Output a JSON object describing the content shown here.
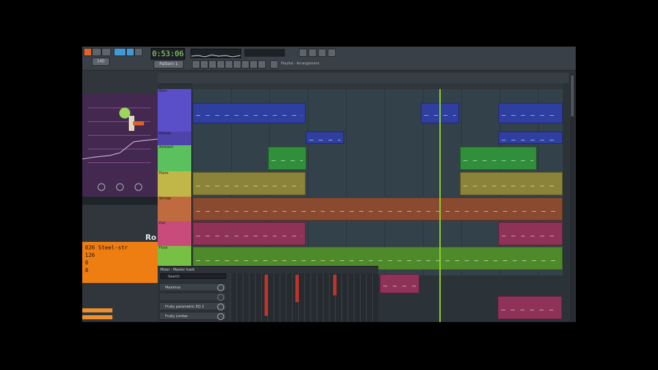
{
  "toolbar": {
    "time": "0:53:06",
    "tempo": "140",
    "pattern": "Pattern 1",
    "hint": "Playlist - Arrangement"
  },
  "left": {
    "roll_label": "Ro",
    "roll_lines": [
      "026 Steel-str",
      "126",
      "0",
      "0"
    ]
  },
  "tracks": [
    {
      "name": "Bass",
      "color": "#5b4fc9"
    },
    {
      "name": "Melody",
      "color": "#5b4fc9"
    },
    {
      "name": "Ambient",
      "color": "#5bc15e"
    },
    {
      "name": "Piano",
      "color": "#c1b648"
    },
    {
      "name": "Strings",
      "color": "#c06a3f"
    },
    {
      "name": "Pad",
      "color": "#c94b7b"
    },
    {
      "name": "Flute",
      "color": "#77c044"
    }
  ],
  "mixer": {
    "title": "Mixer - Master track",
    "search": "Search",
    "plugins": [
      "Maximus",
      "Fruity parametric EQ 2",
      "Fruity Limiter"
    ]
  },
  "colors": {
    "accent": "#ef7e12",
    "playhead": "#8fd129"
  }
}
